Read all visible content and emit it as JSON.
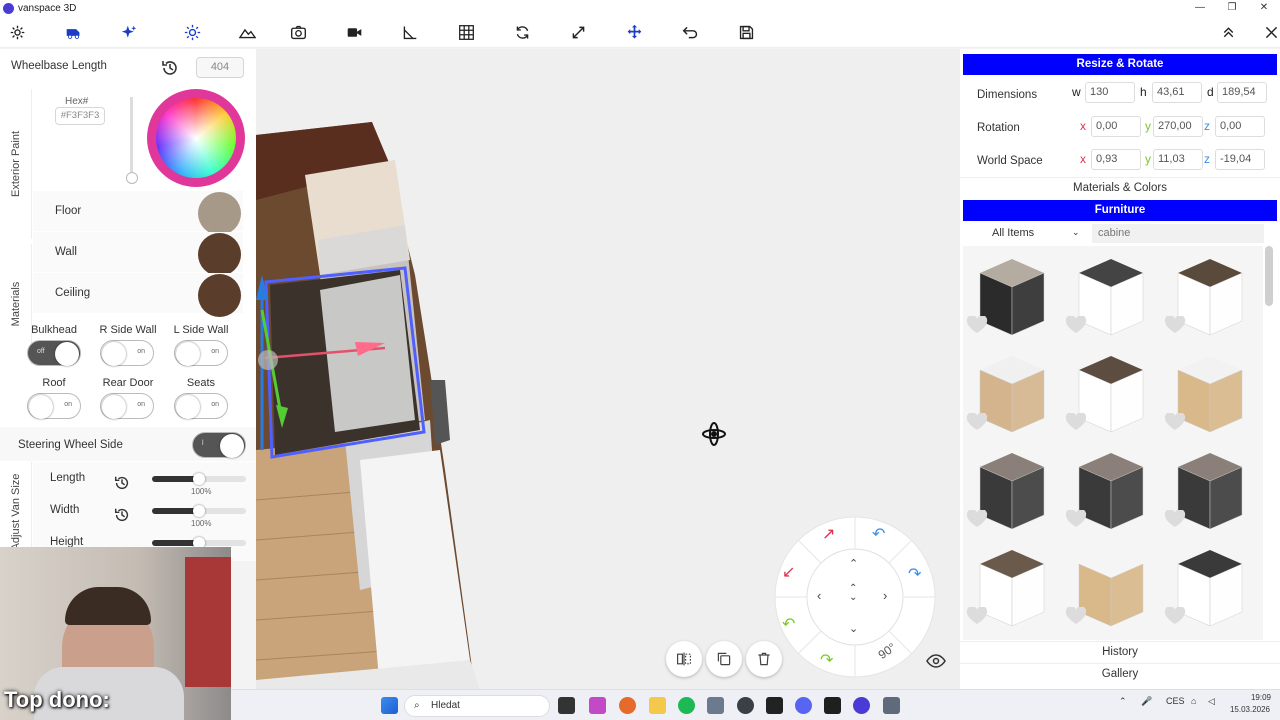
{
  "window": {
    "title": "vanspace 3D",
    "controls": [
      "—",
      "❐",
      "✕"
    ]
  },
  "toolbar": {
    "icons": [
      "gear-icon",
      "van-icon",
      "sparkle-icon",
      "sun-icon",
      "mountain-icon",
      "camera-icon",
      "video-icon",
      "measure-icon",
      "grid-icon",
      "rotate-icon",
      "expand-icon",
      "move-icon",
      "undo-icon",
      "save-icon"
    ],
    "right_icons": [
      "collapse-up-icon",
      "close-icon"
    ]
  },
  "left_panel": {
    "wheelbase": {
      "label": "Wheelbase Length",
      "value": "404"
    },
    "exterior_paint": {
      "tab": "Exterior Paint",
      "hex_label": "Hex#",
      "hex_value": "#F3F3F3"
    },
    "materials": {
      "tab": "Materials",
      "items": [
        {
          "label": "Floor",
          "color": "#a69987"
        },
        {
          "label": "Wall",
          "color": "#5a3d2a"
        },
        {
          "label": "Ceiling",
          "color": "#5a3d2a"
        }
      ]
    },
    "toggles": [
      {
        "label": "Bulkhead",
        "state": "off"
      },
      {
        "label": "R Side Wall",
        "state": "on"
      },
      {
        "label": "L Side Wall",
        "state": "on"
      },
      {
        "label": "Roof",
        "state": "on"
      },
      {
        "label": "Rear Door",
        "state": "on"
      },
      {
        "label": "Seats",
        "state": "on"
      }
    ],
    "steering": {
      "label": "Steering Wheel Side",
      "state": "l"
    },
    "adjust_van": {
      "tab": "Adjust Van Size",
      "sliders": [
        {
          "label": "Length",
          "pct": "100%",
          "value": 0.5
        },
        {
          "label": "Width",
          "pct": "100%",
          "value": 0.5
        },
        {
          "label": "Height",
          "value": 0.5
        }
      ]
    }
  },
  "right_panel": {
    "resize_header": "Resize & Rotate",
    "dimensions": {
      "label": "Dimensions",
      "w_label": "w",
      "w": "130",
      "h_label": "h",
      "h": "43,61",
      "d_label": "d",
      "d": "189,54"
    },
    "rotation": {
      "label": "Rotation",
      "x_label": "x",
      "x": "0,00",
      "y_label": "y",
      "y": "270,00",
      "z_label": "z",
      "z": "0,00"
    },
    "world_space": {
      "label": "World Space",
      "x_label": "x",
      "x": "0,93",
      "y_label": "y",
      "y": "11,03",
      "z_label": "z",
      "z": "-19,04"
    },
    "materials_colors": "Materials & Colors",
    "furniture_header": "Furniture",
    "filter": {
      "selected": "All Items",
      "search_value": "cabine"
    },
    "history": "History",
    "gallery": "Gallery"
  },
  "furniture_grid": [
    {
      "top": "#b5aca1",
      "body": "#2b2b2b"
    },
    {
      "top": "#444444",
      "body": "#ffffff"
    },
    {
      "top": "#5a4a3c",
      "body": "#ffffff"
    },
    {
      "top": "#f0f0f0",
      "body": "#d4b48c"
    },
    {
      "top": "#5d4d40",
      "body": "#ffffff"
    },
    {
      "top": "#f2f2f2",
      "body": "#d9b889"
    },
    {
      "top": "#8a8079",
      "body": "#3a3a3a"
    },
    {
      "top": "#8a8079",
      "body": "#3a3a3a"
    },
    {
      "top": "#8a8079",
      "body": "#3a3a3a"
    },
    {
      "top": "#6a5a4c",
      "body": "#ffffff"
    },
    {
      "top": "#f5f5f5",
      "body": "#d9b889"
    },
    {
      "top": "#3a3a3a",
      "body": "#ffffff"
    }
  ],
  "view_controls": {
    "angle": "90°"
  },
  "webcam": {
    "overlay_text": "Top dono:"
  },
  "taskbar": {
    "search_placeholder": "Hledat",
    "lang": "CES",
    "time": "19:09",
    "date": "15.03.2026"
  },
  "colors": {
    "accent": "#0000ff",
    "wheel_ring": "#e0389a"
  }
}
